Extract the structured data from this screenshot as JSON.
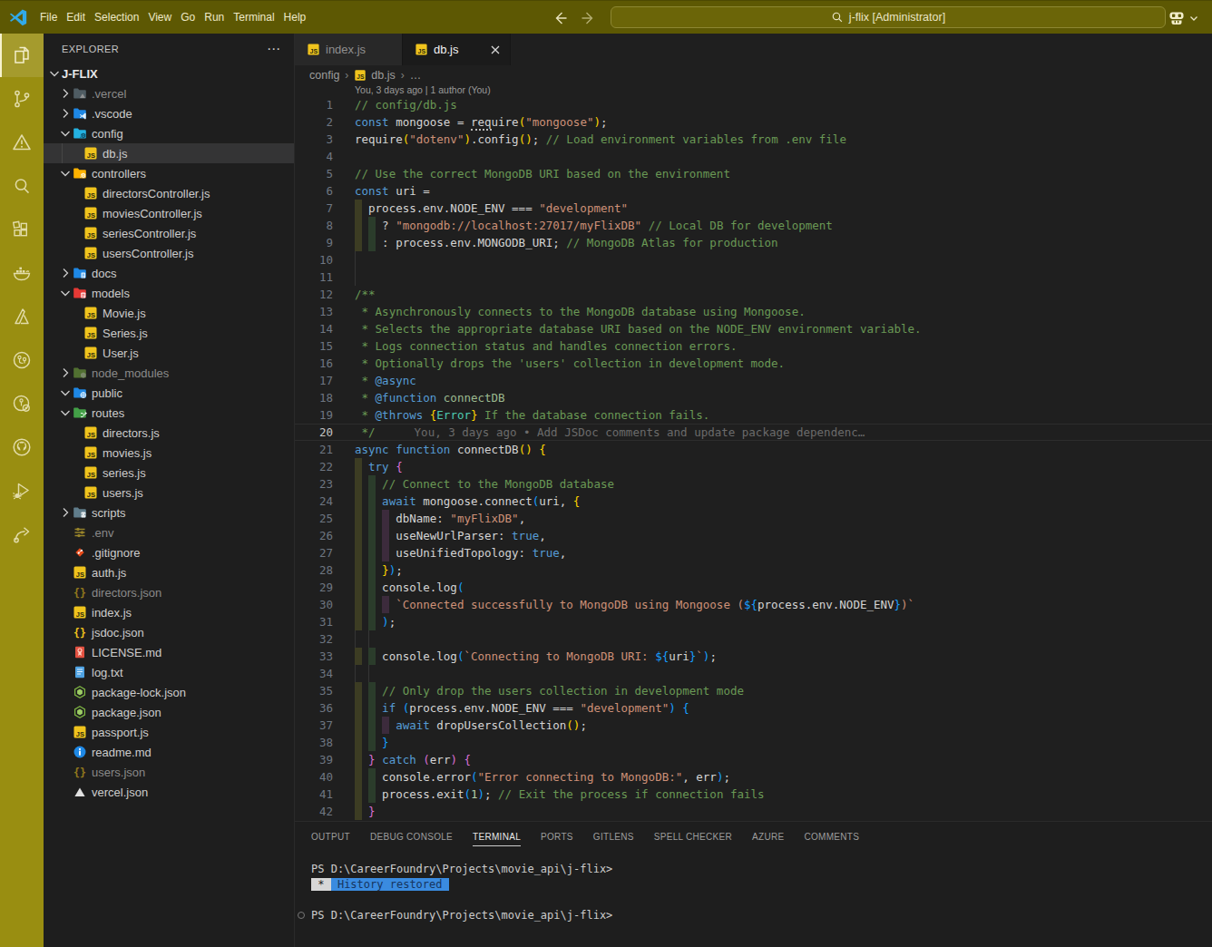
{
  "title_bar": {
    "menus": [
      "File",
      "Edit",
      "Selection",
      "View",
      "Go",
      "Run",
      "Terminal",
      "Help"
    ],
    "search_text": "j-flix [Administrator]",
    "back_enabled": true,
    "forward_enabled": false
  },
  "activity_bar": {
    "items": [
      {
        "icon": "explorer-icon",
        "active": true
      },
      {
        "icon": "source-control-icon",
        "active": false
      },
      {
        "icon": "warning-icon",
        "active": false
      },
      {
        "icon": "search-icon",
        "active": false
      },
      {
        "icon": "extensions-icon",
        "active": false
      },
      {
        "icon": "docker-icon",
        "active": false
      },
      {
        "icon": "azure-icon",
        "active": false
      },
      {
        "icon": "remote-explorer-icon",
        "active": false
      },
      {
        "icon": "gitlens-icon",
        "active": false
      },
      {
        "icon": "github-icon",
        "active": false
      },
      {
        "icon": "run-debug-icon",
        "active": false
      },
      {
        "icon": "live-share-icon",
        "active": false
      }
    ]
  },
  "explorer": {
    "title": "EXPLORER",
    "actions_icon": "⋯",
    "root": "J-FLIX",
    "items": [
      {
        "label": ".vercel",
        "icon": "folder-vercel",
        "depth": 1,
        "chevron": "right",
        "dim": true
      },
      {
        "label": ".vscode",
        "icon": "folder-vscode",
        "depth": 1,
        "chevron": "right"
      },
      {
        "label": "config",
        "icon": "folder-config",
        "depth": 1,
        "chevron": "down"
      },
      {
        "label": "db.js",
        "icon": "js",
        "depth": 2,
        "selected": true,
        "guide": true
      },
      {
        "label": "controllers",
        "icon": "folder-controllers",
        "depth": 1,
        "chevron": "down"
      },
      {
        "label": "directorsController.js",
        "icon": "js",
        "depth": 2
      },
      {
        "label": "moviesController.js",
        "icon": "js",
        "depth": 2
      },
      {
        "label": "seriesController.js",
        "icon": "js",
        "depth": 2
      },
      {
        "label": "usersController.js",
        "icon": "js",
        "depth": 2
      },
      {
        "label": "docs",
        "icon": "folder-docs",
        "depth": 1,
        "chevron": "right"
      },
      {
        "label": "models",
        "icon": "folder-models",
        "depth": 1,
        "chevron": "down"
      },
      {
        "label": "Movie.js",
        "icon": "js",
        "depth": 2
      },
      {
        "label": "Series.js",
        "icon": "js",
        "depth": 2
      },
      {
        "label": "User.js",
        "icon": "js",
        "depth": 2
      },
      {
        "label": "node_modules",
        "icon": "folder-node",
        "depth": 1,
        "chevron": "right",
        "dim": true
      },
      {
        "label": "public",
        "icon": "folder-public",
        "depth": 1,
        "chevron": "down"
      },
      {
        "label": "routes",
        "icon": "folder-routes",
        "depth": 1,
        "chevron": "down"
      },
      {
        "label": "directors.js",
        "icon": "js",
        "depth": 2
      },
      {
        "label": "movies.js",
        "icon": "js",
        "depth": 2
      },
      {
        "label": "series.js",
        "icon": "js",
        "depth": 2
      },
      {
        "label": "users.js",
        "icon": "js",
        "depth": 2
      },
      {
        "label": "scripts",
        "icon": "folder-scripts",
        "depth": 1,
        "chevron": "right"
      },
      {
        "label": ".env",
        "icon": "env",
        "depth": 1,
        "dim": true
      },
      {
        "label": ".gitignore",
        "icon": "git",
        "depth": 1
      },
      {
        "label": "auth.js",
        "icon": "js",
        "depth": 1
      },
      {
        "label": "directors.json",
        "icon": "json",
        "depth": 1,
        "dim": true
      },
      {
        "label": "index.js",
        "icon": "js",
        "depth": 1
      },
      {
        "label": "jsdoc.json",
        "icon": "json",
        "depth": 1
      },
      {
        "label": "LICENSE.md",
        "icon": "license",
        "depth": 1
      },
      {
        "label": "log.txt",
        "icon": "log",
        "depth": 1
      },
      {
        "label": "package-lock.json",
        "icon": "npm",
        "depth": 1
      },
      {
        "label": "package.json",
        "icon": "npm",
        "depth": 1
      },
      {
        "label": "passport.js",
        "icon": "js",
        "depth": 1
      },
      {
        "label": "readme.md",
        "icon": "readme",
        "depth": 1
      },
      {
        "label": "users.json",
        "icon": "json",
        "depth": 1,
        "dim": true
      },
      {
        "label": "vercel.json",
        "icon": "vercel",
        "depth": 1
      }
    ]
  },
  "editor_tabs": [
    {
      "label": "index.js",
      "icon": "js",
      "active": false
    },
    {
      "label": "db.js",
      "icon": "js",
      "active": true,
      "closable": true
    }
  ],
  "breadcrumbs": {
    "folder": "config",
    "file": "db.js",
    "more": "…",
    "sep": "›"
  },
  "editor": {
    "top_blame": "You, 3 days ago | 1 author (You)",
    "inline_blame": "You, 3 days ago • Add JSDoc comments and update package dependenc…",
    "current_line": 20,
    "lines": [
      {
        "n": 1,
        "s": [
          [
            "c",
            "// config/db.js"
          ]
        ]
      },
      {
        "n": 2,
        "s": [
          [
            "k",
            "const"
          ],
          [
            "p",
            " mongoose = "
          ],
          [
            "u",
            "req"
          ],
          [
            "p",
            "uire"
          ],
          [
            "b1",
            "("
          ],
          [
            "s",
            "\"mongoose\""
          ],
          [
            "b1",
            ")"
          ],
          [
            "p",
            ";"
          ]
        ]
      },
      {
        "n": 3,
        "s": [
          [
            "p",
            "require"
          ],
          [
            "b1",
            "("
          ],
          [
            "s",
            "\"dotenv\""
          ],
          [
            "b1",
            ")"
          ],
          [
            "p",
            ".config"
          ],
          [
            "b1",
            "()"
          ],
          [
            "p",
            "; "
          ],
          [
            "c",
            "// Load environment variables from .env file"
          ]
        ]
      },
      {
        "n": 4,
        "s": []
      },
      {
        "n": 5,
        "s": [
          [
            "c",
            "// Use the correct MongoDB URI based on the environment"
          ]
        ]
      },
      {
        "n": 6,
        "s": [
          [
            "k",
            "const"
          ],
          [
            "p",
            " uri ="
          ]
        ]
      },
      {
        "n": 7,
        "s": [
          [
            "p",
            "  process.env.NODE_ENV === "
          ],
          [
            "s",
            "\"development\""
          ]
        ]
      },
      {
        "n": 8,
        "s": [
          [
            "p",
            "    ? "
          ],
          [
            "s",
            "\"mongodb://localhost:27017/myFlixDB\""
          ],
          [
            "p",
            " "
          ],
          [
            "c",
            "// Local DB for development"
          ]
        ]
      },
      {
        "n": 9,
        "s": [
          [
            "p",
            "    : process.env.MONGODB_URI; "
          ],
          [
            "c",
            "// MongoDB Atlas for production"
          ]
        ]
      },
      {
        "n": 10,
        "s": [],
        "guides": [
          0
        ]
      },
      {
        "n": 11,
        "s": [],
        "guides": [
          0
        ]
      },
      {
        "n": 12,
        "s": [
          [
            "c",
            "/**"
          ]
        ]
      },
      {
        "n": 13,
        "s": [
          [
            "c",
            " * Asynchronously connects to the MongoDB database using Mongoose."
          ]
        ]
      },
      {
        "n": 14,
        "s": [
          [
            "c",
            " * Selects the appropriate database URI based on the NODE_ENV environment variable."
          ]
        ]
      },
      {
        "n": 15,
        "s": [
          [
            "c",
            " * Logs connection status and handles connection errors."
          ]
        ]
      },
      {
        "n": 16,
        "s": [
          [
            "c",
            " * Optionally drops the 'users' collection in development mode."
          ]
        ]
      },
      {
        "n": 17,
        "s": [
          [
            "c",
            " * "
          ],
          [
            "k",
            "@async"
          ]
        ]
      },
      {
        "n": 18,
        "s": [
          [
            "c",
            " * "
          ],
          [
            "k",
            "@function"
          ],
          [
            "jg",
            " connectDB"
          ]
        ]
      },
      {
        "n": 19,
        "s": [
          [
            "c",
            " * "
          ],
          [
            "k",
            "@throws"
          ],
          [
            "p",
            " "
          ],
          [
            "b1",
            "{"
          ],
          [
            "ty",
            "Error"
          ],
          [
            "b1",
            "}"
          ],
          [
            "c",
            " If the database connection fails."
          ]
        ]
      },
      {
        "n": 20,
        "s": [
          [
            "c",
            " */"
          ]
        ],
        "blame": true
      },
      {
        "n": 21,
        "s": [
          [
            "k",
            "async"
          ],
          [
            "p",
            " "
          ],
          [
            "k",
            "function"
          ],
          [
            "p",
            " connectDB"
          ],
          [
            "b1",
            "()"
          ],
          [
            "p",
            " "
          ],
          [
            "b1",
            "{"
          ]
        ]
      },
      {
        "n": 22,
        "s": [
          [
            "p",
            "  "
          ],
          [
            "k",
            "try"
          ],
          [
            "p",
            " "
          ],
          [
            "b2",
            "{"
          ]
        ]
      },
      {
        "n": 23,
        "s": [
          [
            "c",
            "    // Connect to the MongoDB database"
          ]
        ]
      },
      {
        "n": 24,
        "s": [
          [
            "p",
            "    "
          ],
          [
            "k",
            "await"
          ],
          [
            "p",
            " mongoose.connect"
          ],
          [
            "b3",
            "("
          ],
          [
            "p",
            "uri, "
          ],
          [
            "b1",
            "{"
          ]
        ]
      },
      {
        "n": 25,
        "s": [
          [
            "p",
            "      dbName: "
          ],
          [
            "s",
            "\"myFlixDB\""
          ],
          [
            "p",
            ","
          ]
        ]
      },
      {
        "n": 26,
        "s": [
          [
            "p",
            "      useNewUrlParser: "
          ],
          [
            "k",
            "true"
          ],
          [
            "p",
            ","
          ]
        ]
      },
      {
        "n": 27,
        "s": [
          [
            "p",
            "      useUnifiedTopology: "
          ],
          [
            "k",
            "true"
          ],
          [
            "p",
            ","
          ]
        ]
      },
      {
        "n": 28,
        "s": [
          [
            "p",
            "    "
          ],
          [
            "b1",
            "}"
          ],
          [
            "b3",
            ")"
          ],
          [
            "p",
            ";"
          ]
        ]
      },
      {
        "n": 29,
        "s": [
          [
            "p",
            "    console.log"
          ],
          [
            "b3",
            "("
          ]
        ]
      },
      {
        "n": 30,
        "s": [
          [
            "s",
            "      `Connected successfully to MongoDB using Mongoose ("
          ],
          [
            "b3",
            "${"
          ],
          [
            "p",
            "process.env.NODE_ENV"
          ],
          [
            "b3",
            "}"
          ],
          [
            "s",
            ")`"
          ]
        ]
      },
      {
        "n": 31,
        "s": [
          [
            "p",
            "    "
          ],
          [
            "b3",
            ")"
          ],
          [
            "p",
            ";"
          ]
        ]
      },
      {
        "n": 32,
        "s": [],
        "guides": [
          0,
          1
        ]
      },
      {
        "n": 33,
        "s": [
          [
            "p",
            "    console.log"
          ],
          [
            "b3",
            "("
          ],
          [
            "s",
            "`Connecting to MongoDB URI: "
          ],
          [
            "b3",
            "${"
          ],
          [
            "p",
            "uri"
          ],
          [
            "b3",
            "}"
          ],
          [
            "s",
            "`"
          ],
          [
            "b3",
            ")"
          ],
          [
            "p",
            ";"
          ]
        ]
      },
      {
        "n": 34,
        "s": [],
        "guides": [
          0,
          1
        ]
      },
      {
        "n": 35,
        "s": [
          [
            "c",
            "    // Only drop the users collection in development mode"
          ]
        ]
      },
      {
        "n": 36,
        "s": [
          [
            "p",
            "    "
          ],
          [
            "k",
            "if"
          ],
          [
            "p",
            " "
          ],
          [
            "b3",
            "("
          ],
          [
            "p",
            "process.env.NODE_ENV === "
          ],
          [
            "s",
            "\"development\""
          ],
          [
            "b3",
            ")"
          ],
          [
            "p",
            " "
          ],
          [
            "b3",
            "{"
          ]
        ]
      },
      {
        "n": 37,
        "s": [
          [
            "p",
            "      "
          ],
          [
            "k",
            "await"
          ],
          [
            "p",
            " dropUsersCollection"
          ],
          [
            "b1",
            "()"
          ],
          [
            "p",
            ";"
          ]
        ]
      },
      {
        "n": 38,
        "s": [
          [
            "p",
            "    "
          ],
          [
            "b3",
            "}"
          ]
        ]
      },
      {
        "n": 39,
        "s": [
          [
            "p",
            "  "
          ],
          [
            "b2",
            "}"
          ],
          [
            "p",
            " "
          ],
          [
            "k",
            "catch"
          ],
          [
            "p",
            " "
          ],
          [
            "b2",
            "("
          ],
          [
            "p",
            "err"
          ],
          [
            "b2",
            ")"
          ],
          [
            "p",
            " "
          ],
          [
            "b2",
            "{"
          ]
        ]
      },
      {
        "n": 40,
        "s": [
          [
            "p",
            "    console.error"
          ],
          [
            "b3",
            "("
          ],
          [
            "s",
            "\"Error connecting to MongoDB:\""
          ],
          [
            "p",
            ", err"
          ],
          [
            "b3",
            ")"
          ],
          [
            "p",
            ";"
          ]
        ]
      },
      {
        "n": 41,
        "s": [
          [
            "p",
            "    process.exit"
          ],
          [
            "b3",
            "("
          ],
          [
            "n2",
            "1"
          ],
          [
            "b3",
            ")"
          ],
          [
            "p",
            "; "
          ],
          [
            "c",
            "// Exit the process if connection fails"
          ]
        ]
      },
      {
        "n": 42,
        "s": [
          [
            "p",
            "  "
          ],
          [
            "b2",
            "}"
          ]
        ]
      }
    ]
  },
  "panel": {
    "tabs": [
      {
        "label": "OUTPUT",
        "active": false
      },
      {
        "label": "DEBUG CONSOLE",
        "active": false
      },
      {
        "label": "TERMINAL",
        "active": true
      },
      {
        "label": "PORTS",
        "active": false
      },
      {
        "label": "GITLENS",
        "active": false
      },
      {
        "label": "SPELL CHECKER",
        "active": false
      },
      {
        "label": "AZURE",
        "active": false
      },
      {
        "label": "COMMENTS",
        "active": false
      }
    ],
    "terminal": [
      {
        "text": "PS D:\\CareerFoundry\\Projects\\movie_api\\j-flix>"
      },
      {
        "badge_star": " * ",
        "badge_msg": " History restored "
      },
      {
        "text": ""
      },
      {
        "text": "PS D:\\CareerFoundry\\Projects\\movie_api\\j-flix>",
        "decoration": true
      }
    ]
  }
}
